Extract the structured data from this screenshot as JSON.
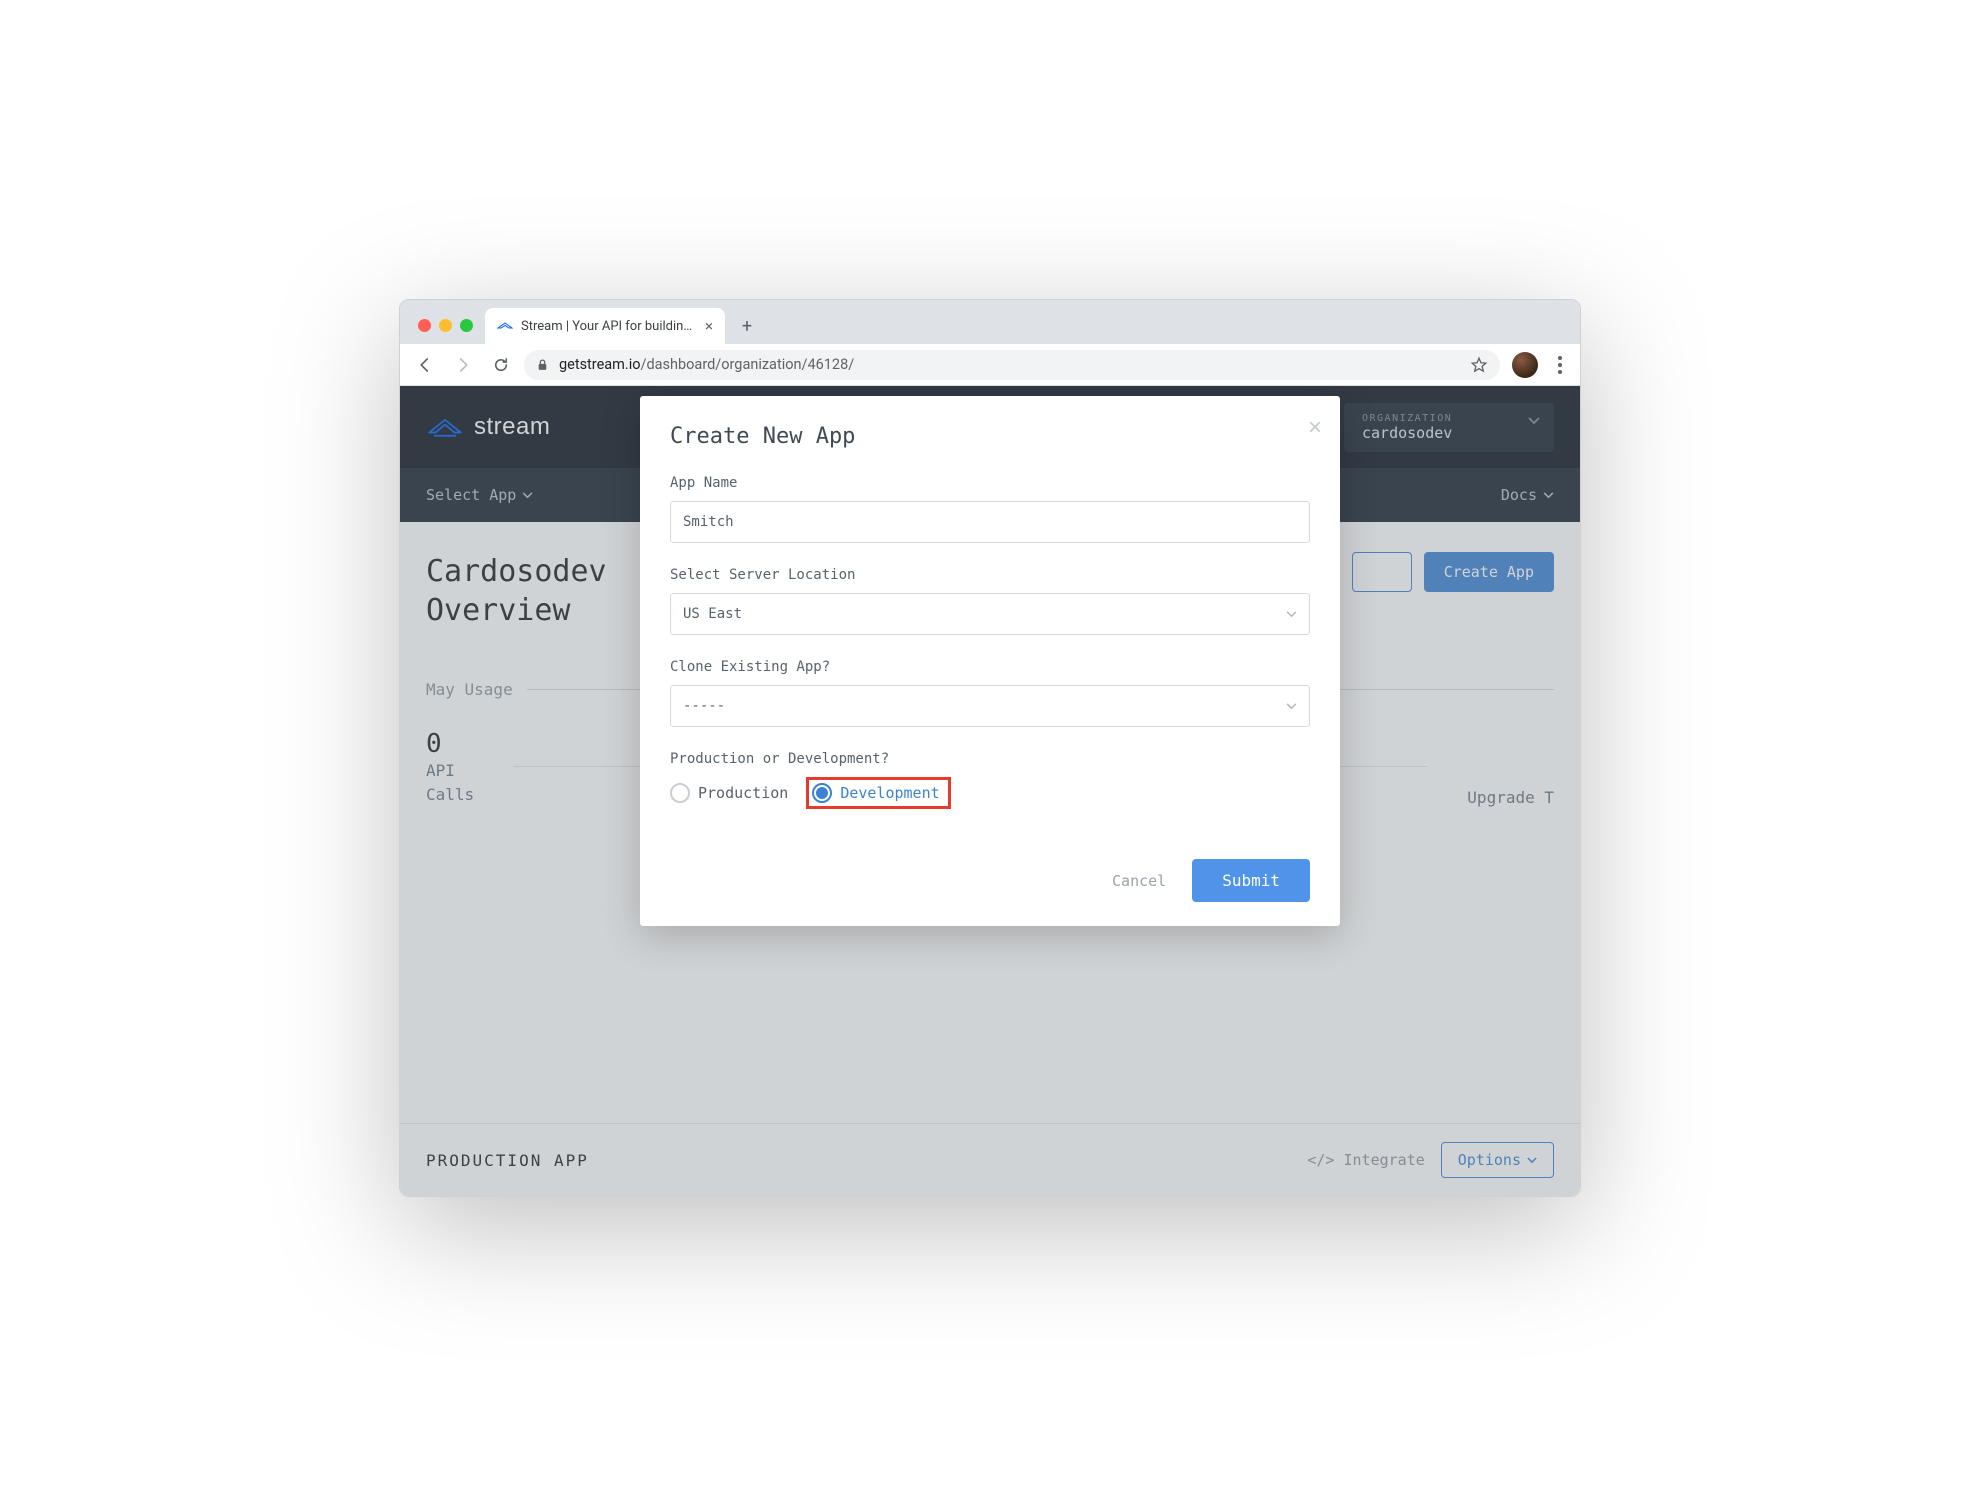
{
  "browser": {
    "tab_title": "Stream | Your API for building a",
    "url_host": "getstream.io",
    "url_path": "/dashboard/organization/46128/"
  },
  "header": {
    "logo_text": "stream",
    "org_label": "ORGANIZATION",
    "org_value": "cardosodev"
  },
  "subnav": {
    "select_app": "Select App",
    "docs": "Docs"
  },
  "page": {
    "title_line1": "Cardosodev",
    "title_line2": "Overview",
    "usage_label": "May Usage",
    "stat_value": "0",
    "stat_label_line1": "API",
    "stat_label_line2": "Calls",
    "upgrade": "Upgrade T",
    "create_app_btn": "Create App",
    "prod_app_label": "PRODUCTION APP",
    "integrate": "</> Integrate",
    "options": "Options"
  },
  "modal": {
    "title": "Create New App",
    "app_name_label": "App Name",
    "app_name_value": "Smitch",
    "server_label": "Select Server Location",
    "server_value": "US East",
    "clone_label": "Clone Existing App?",
    "clone_value": "-----",
    "env_label": "Production or Development?",
    "radio_production": "Production",
    "radio_development": "Development",
    "cancel": "Cancel",
    "submit": "Submit"
  }
}
